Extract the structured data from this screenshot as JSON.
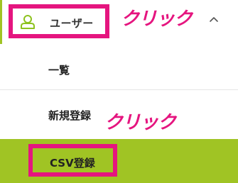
{
  "sidebar": {
    "users_section": {
      "icon": "user-icon",
      "label": "ユーザー",
      "expanded_icon": "chevron-up-icon"
    },
    "items": [
      {
        "label": "一覧"
      },
      {
        "label": "新規登録"
      },
      {
        "label": "CSV登録",
        "active": true
      }
    ]
  },
  "annotations": [
    {
      "text": "クリック"
    },
    {
      "text": "クリック"
    }
  ],
  "colors": {
    "accent": "#a0c424",
    "highlight": "#e5157f",
    "icon": "#8dc21f"
  }
}
